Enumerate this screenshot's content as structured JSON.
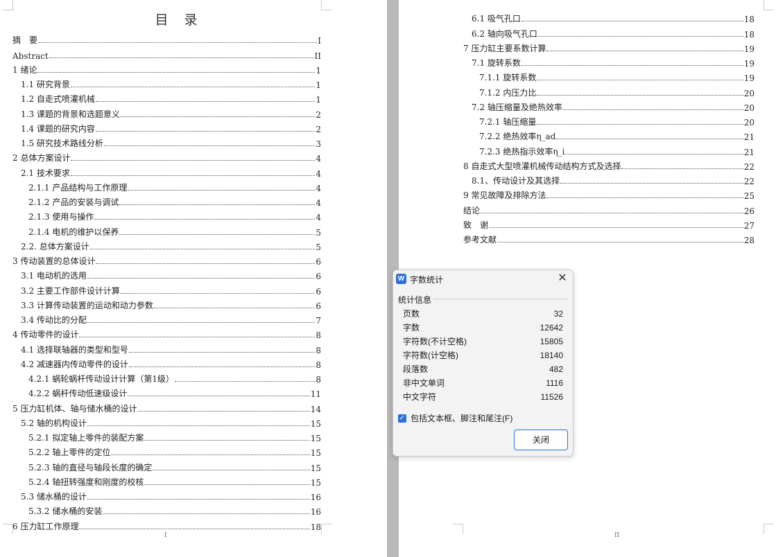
{
  "toc_title": "目　录",
  "left_page": {
    "page_number": "I",
    "entries": [
      {
        "text": "摘　要",
        "page": "I",
        "level": 1
      },
      {
        "text": "Abstract",
        "page": "II",
        "level": 1
      },
      {
        "text": "1 绪论",
        "page": "1",
        "level": 1
      },
      {
        "text": "1.1 研究背景",
        "page": "1",
        "level": 2
      },
      {
        "text": "1.2 自走式喷灌机械",
        "page": "1",
        "level": 2
      },
      {
        "text": "1.3 课题的背景和选题意义",
        "page": "2",
        "level": 2
      },
      {
        "text": "1.4 课题的研究内容",
        "page": "2",
        "level": 2
      },
      {
        "text": "1.5 研究技术路线分析",
        "page": "3",
        "level": 2
      },
      {
        "text": "2 总体方案设计",
        "page": "4",
        "level": 1
      },
      {
        "text": "2.1 技术要求",
        "page": "4",
        "level": 2
      },
      {
        "text": "2.1.1 产品结构与工作原理",
        "page": "4",
        "level": 3
      },
      {
        "text": "2.1.2 产品的安装与调试",
        "page": "4",
        "level": 3
      },
      {
        "text": "2.1.3 使用与操作",
        "page": "4",
        "level": 3
      },
      {
        "text": "2.1.4 电机的维护以保养",
        "page": "5",
        "level": 3
      },
      {
        "text": "2.2. 总体方案设计",
        "page": "5",
        "level": 2
      },
      {
        "text": "3 传动装置的总体设计",
        "page": "6",
        "level": 1
      },
      {
        "text": "3.1 电动机的选用",
        "page": "6",
        "level": 2
      },
      {
        "text": "3.2 主要工作部件设计计算",
        "page": "6",
        "level": 2
      },
      {
        "text": "3.3 计算传动装置的运动和动力参数",
        "page": "6",
        "level": 2
      },
      {
        "text": "3.4 传动比的分配",
        "page": "7",
        "level": 2
      },
      {
        "text": "4 传动零件的设计",
        "page": "8",
        "level": 1
      },
      {
        "text": "4.1 选择联轴器的类型和型号",
        "page": "8",
        "level": 2
      },
      {
        "text": "4.2 减速器内传动零件的设计",
        "page": "8",
        "level": 2
      },
      {
        "text": "4.2.1 蜗轮蜗杆传动设计计算（第1级）",
        "page": "8",
        "level": 3
      },
      {
        "text": "4.2.2 蜗杆传动低速级设计",
        "page": "11",
        "level": 3
      },
      {
        "text": "5 压力缸机体、轴与储水桶的设计",
        "page": "14",
        "level": 1
      },
      {
        "text": "5.2 轴的机构设计",
        "page": "15",
        "level": 2
      },
      {
        "text": "5.2.1 拟定轴上零件的装配方案",
        "page": "15",
        "level": 3
      },
      {
        "text": "5.2.2 轴上零件的定位",
        "page": "15",
        "level": 3
      },
      {
        "text": "5.2.3 轴的直径与轴段长度的确定",
        "page": "15",
        "level": 3
      },
      {
        "text": "5.2.4 轴扭转强度和刚度的校核",
        "page": "15",
        "level": 3
      },
      {
        "text": "5.3 储水桶的设计",
        "page": "16",
        "level": 2
      },
      {
        "text": "5.3.2 储水桶的安装",
        "page": "16",
        "level": 3
      },
      {
        "text": "6 压力缸工作原理",
        "page": "18",
        "level": 1
      }
    ]
  },
  "right_page": {
    "page_number": "II",
    "entries": [
      {
        "text": "6.1 吸气孔口",
        "page": "18",
        "level": 2
      },
      {
        "text": "6.2 轴向吸气孔口",
        "page": "18",
        "level": 2
      },
      {
        "text": "7 压力缸主要系数计算",
        "page": "19",
        "level": 1
      },
      {
        "text": "7.1 旋转系数",
        "page": "19",
        "level": 2
      },
      {
        "text": "7.1.1 旋转系数",
        "page": "19",
        "level": 3
      },
      {
        "text": "7.1.2 内压力比",
        "page": "20",
        "level": 3
      },
      {
        "text": "7.2 轴压缩量及绝热效率",
        "page": "20",
        "level": 2
      },
      {
        "text": "7.2.1 轴压缩量",
        "page": "20",
        "level": 3
      },
      {
        "text": "7.2.2 绝热效率η_ad",
        "page": "21",
        "level": 3
      },
      {
        "text": "7.2.3 绝热指示效率η_i",
        "page": "21",
        "level": 3
      },
      {
        "text": "8 自走式大型喷灌机械传动结构方式及选择",
        "page": "22",
        "level": 1
      },
      {
        "text": "8.1、传动设计及其选择",
        "page": "22",
        "level": 2
      },
      {
        "text": "9 常见故障及排除方法",
        "page": "25",
        "level": 1
      },
      {
        "text": "结论",
        "page": "26",
        "level": 1
      },
      {
        "text": "致　谢",
        "page": "27",
        "level": 1
      },
      {
        "text": "参考文献",
        "page": "28",
        "level": 1
      }
    ]
  },
  "dialog": {
    "icon_glyph": "W",
    "title": "字数统计",
    "group_label": "统计信息",
    "stats": [
      {
        "label": "页数",
        "value": "32"
      },
      {
        "label": "字数",
        "value": "12642"
      },
      {
        "label": "字符数(不计空格)",
        "value": "15805"
      },
      {
        "label": "字符数(计空格)",
        "value": "18140"
      },
      {
        "label": "段落数",
        "value": "482"
      },
      {
        "label": "非中文单词",
        "value": "1116"
      },
      {
        "label": "中文字符",
        "value": "11526"
      }
    ],
    "checkbox_label": "包括文本框、脚注和尾注(F)",
    "checkbox_checked": true,
    "close_button_label": "关闭",
    "accent_color": "#2b6fd8"
  }
}
